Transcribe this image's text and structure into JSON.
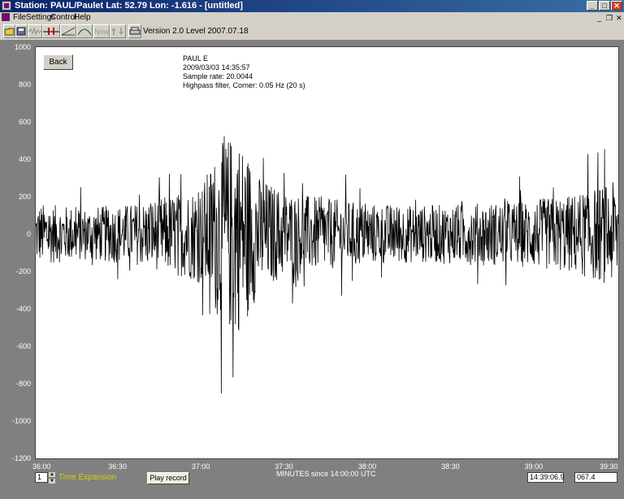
{
  "window": {
    "title": "Station: PAUL/Paulet Lat: 52.79 Lon: -1.616 - [untitled]",
    "minimize_label": "_",
    "maximize_label": "□",
    "close_label": "✕"
  },
  "menu": {
    "items": [
      "File",
      "Settings",
      "Control",
      "Help"
    ],
    "mdi_controls": [
      "_",
      "❐",
      "✕"
    ]
  },
  "toolbar": {
    "now_label": "Now",
    "version_text": "Version 2.0 Level 2007.07.18"
  },
  "plot": {
    "back_label": "Back",
    "info_lines": [
      "PAUL E",
      "2009/03/03 14:35:57",
      "Sample rate: 20.0044",
      "Highpass filter, Corner: 0.05 Hz (20 s)"
    ]
  },
  "bottom": {
    "expansion_value": "1",
    "time_expansion_label": "Time Expansion",
    "play_record_label": "Play record",
    "cursor_time": "14:39:06.9",
    "cursor_value": "067.4"
  },
  "chart_data": {
    "type": "line",
    "title": "",
    "xlabel": "MINUTES since 14:00:00 UTC",
    "ylabel": "",
    "x_tick_labels": [
      "36:00",
      "36:30",
      "37:00",
      "37:30",
      "38:00",
      "38:30",
      "39:00",
      "39:30"
    ],
    "y_tick_labels": [
      "1000",
      "800",
      "600",
      "400",
      "200",
      "0",
      "-200",
      "-400",
      "-600",
      "-800",
      "-1000",
      "-1200"
    ],
    "xlim": [
      36.0,
      39.5
    ],
    "ylim": [
      -1200,
      1000
    ],
    "grid": false,
    "series": [
      {
        "color": "#000000",
        "envelope_description": "seismogram trace; peak amplitude about 950 near 37:08 to 37:25, minimum about -1010 near 37:16, background amplitude about 250",
        "envelope_x": [
          36.0,
          36.3,
          36.6,
          36.9,
          37.0,
          37.1,
          37.15,
          37.2,
          37.25,
          37.35,
          37.5,
          37.7,
          38.0,
          38.3,
          38.6,
          38.9,
          39.2,
          39.5
        ],
        "envelope_amplitude": [
          300,
          260,
          300,
          420,
          500,
          850,
          950,
          1000,
          880,
          550,
          420,
          360,
          300,
          280,
          300,
          320,
          380,
          520
        ]
      }
    ]
  }
}
